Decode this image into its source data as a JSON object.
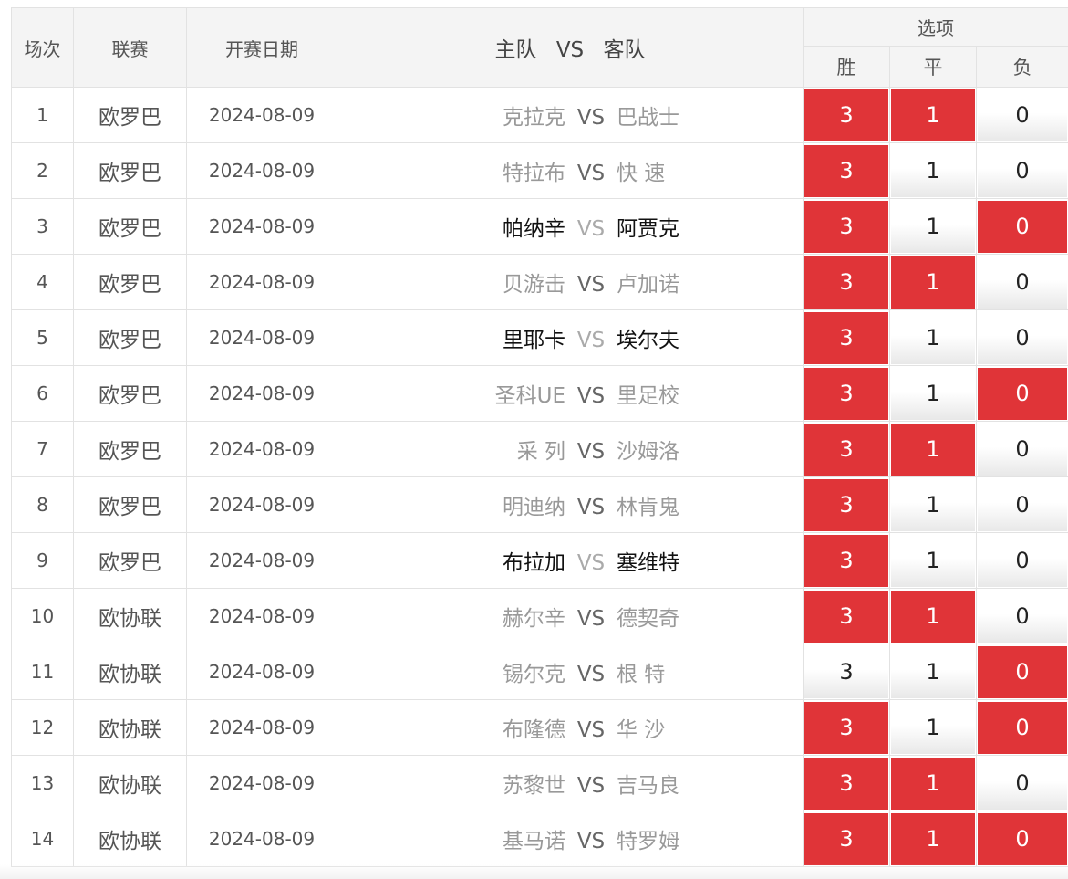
{
  "header": {
    "col_no": "场次",
    "col_league": "联赛",
    "col_date": "开赛日期",
    "col_home": "主队",
    "col_vs": "VS",
    "col_away": "客队",
    "col_options": "选项",
    "opt_win": "胜",
    "opt_draw": "平",
    "opt_lose": "负"
  },
  "colors": {
    "selected": "#e03438",
    "unselected_text": "#999999",
    "highlight_text": "#111111"
  },
  "matches": [
    {
      "no": "1",
      "league": "欧罗巴",
      "date": "2024-08-09",
      "home": "克拉克",
      "vs": "VS",
      "away": "巴战士",
      "highlight": false,
      "win": "3",
      "draw": "1",
      "lose": "0",
      "win_sel": true,
      "draw_sel": true,
      "lose_sel": false
    },
    {
      "no": "2",
      "league": "欧罗巴",
      "date": "2024-08-09",
      "home": "特拉布",
      "vs": "VS",
      "away": "快 速",
      "highlight": false,
      "win": "3",
      "draw": "1",
      "lose": "0",
      "win_sel": true,
      "draw_sel": false,
      "lose_sel": false
    },
    {
      "no": "3",
      "league": "欧罗巴",
      "date": "2024-08-09",
      "home": "帕纳辛",
      "vs": "VS",
      "away": "阿贾克",
      "highlight": true,
      "win": "3",
      "draw": "1",
      "lose": "0",
      "win_sel": true,
      "draw_sel": false,
      "lose_sel": true
    },
    {
      "no": "4",
      "league": "欧罗巴",
      "date": "2024-08-09",
      "home": "贝游击",
      "vs": "VS",
      "away": "卢加诺",
      "highlight": false,
      "win": "3",
      "draw": "1",
      "lose": "0",
      "win_sel": true,
      "draw_sel": true,
      "lose_sel": false
    },
    {
      "no": "5",
      "league": "欧罗巴",
      "date": "2024-08-09",
      "home": "里耶卡",
      "vs": "VS",
      "away": "埃尔夫",
      "highlight": true,
      "win": "3",
      "draw": "1",
      "lose": "0",
      "win_sel": true,
      "draw_sel": false,
      "lose_sel": false
    },
    {
      "no": "6",
      "league": "欧罗巴",
      "date": "2024-08-09",
      "home": "圣科UE",
      "vs": "VS",
      "away": "里足校",
      "highlight": false,
      "win": "3",
      "draw": "1",
      "lose": "0",
      "win_sel": true,
      "draw_sel": false,
      "lose_sel": true
    },
    {
      "no": "7",
      "league": "欧罗巴",
      "date": "2024-08-09",
      "home": "采 列",
      "vs": "VS",
      "away": "沙姆洛",
      "highlight": false,
      "win": "3",
      "draw": "1",
      "lose": "0",
      "win_sel": true,
      "draw_sel": true,
      "lose_sel": false
    },
    {
      "no": "8",
      "league": "欧罗巴",
      "date": "2024-08-09",
      "home": "明迪纳",
      "vs": "VS",
      "away": "林肯鬼",
      "highlight": false,
      "win": "3",
      "draw": "1",
      "lose": "0",
      "win_sel": true,
      "draw_sel": false,
      "lose_sel": false
    },
    {
      "no": "9",
      "league": "欧罗巴",
      "date": "2024-08-09",
      "home": "布拉加",
      "vs": "VS",
      "away": "塞维特",
      "highlight": true,
      "win": "3",
      "draw": "1",
      "lose": "0",
      "win_sel": true,
      "draw_sel": false,
      "lose_sel": false
    },
    {
      "no": "10",
      "league": "欧协联",
      "date": "2024-08-09",
      "home": "赫尔辛",
      "vs": "VS",
      "away": "德契奇",
      "highlight": false,
      "win": "3",
      "draw": "1",
      "lose": "0",
      "win_sel": true,
      "draw_sel": true,
      "lose_sel": false
    },
    {
      "no": "11",
      "league": "欧协联",
      "date": "2024-08-09",
      "home": "锡尔克",
      "vs": "VS",
      "away": "根 特",
      "highlight": false,
      "win": "3",
      "draw": "1",
      "lose": "0",
      "win_sel": false,
      "draw_sel": false,
      "lose_sel": true
    },
    {
      "no": "12",
      "league": "欧协联",
      "date": "2024-08-09",
      "home": "布隆德",
      "vs": "VS",
      "away": "华 沙",
      "highlight": false,
      "win": "3",
      "draw": "1",
      "lose": "0",
      "win_sel": true,
      "draw_sel": false,
      "lose_sel": true
    },
    {
      "no": "13",
      "league": "欧协联",
      "date": "2024-08-09",
      "home": "苏黎世",
      "vs": "VS",
      "away": "吉马良",
      "highlight": false,
      "win": "3",
      "draw": "1",
      "lose": "0",
      "win_sel": true,
      "draw_sel": true,
      "lose_sel": false
    },
    {
      "no": "14",
      "league": "欧协联",
      "date": "2024-08-09",
      "home": "基马诺",
      "vs": "VS",
      "away": "特罗姆",
      "highlight": false,
      "win": "3",
      "draw": "1",
      "lose": "0",
      "win_sel": true,
      "draw_sel": true,
      "lose_sel": true
    }
  ]
}
